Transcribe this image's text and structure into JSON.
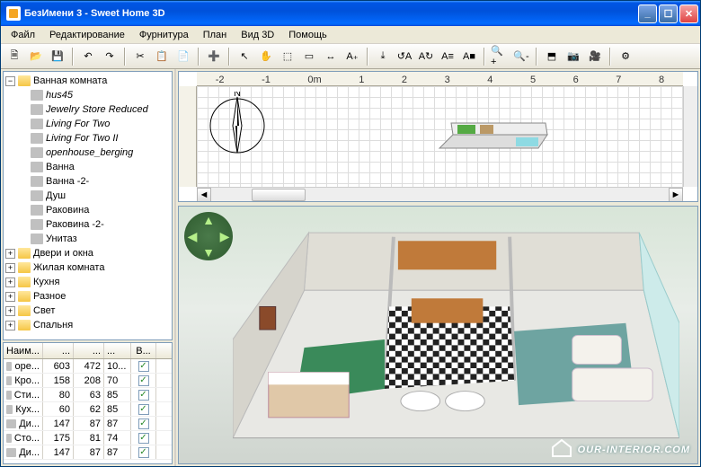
{
  "window": {
    "title": "БезИмени 3 - Sweet Home 3D",
    "min_label": "_",
    "max_label": "☐",
    "close_label": "✕"
  },
  "menu": {
    "file": "Файл",
    "edit": "Редактирование",
    "furniture": "Фурнитура",
    "plan": "План",
    "view3d": "Вид 3D",
    "help": "Помощь"
  },
  "toolbar_icons": {
    "new": "🗎",
    "open": "📂",
    "save": "💾",
    "undo": "↶",
    "redo": "↷",
    "cut": "✂",
    "copy": "📋",
    "paste": "📄",
    "add_furn": "➕",
    "select": "↖",
    "pan": "✋",
    "wall": "⬚",
    "room": "▭",
    "dimension": "↔",
    "text": "A₊",
    "import": "⤓",
    "rotate_left": "↺A",
    "rotate_right": "A↻",
    "align": "A≡",
    "color": "A■",
    "zoom_in": "🔍+",
    "zoom_out": "🔍-",
    "view_top": "⬒",
    "photo": "📷",
    "video": "🎥",
    "prefs": "⚙"
  },
  "catalog": {
    "root": "Ванная комната",
    "items": [
      {
        "label": "hus45",
        "italic": true
      },
      {
        "label": "Jewelry Store Reduced",
        "italic": true
      },
      {
        "label": "Living For Two",
        "italic": true
      },
      {
        "label": "Living For Two II",
        "italic": true
      },
      {
        "label": "openhouse_berging",
        "italic": true
      },
      {
        "label": "Ванна",
        "italic": false
      },
      {
        "label": "Ванна -2-",
        "italic": false
      },
      {
        "label": "Душ",
        "italic": false
      },
      {
        "label": "Раковина",
        "italic": false
      },
      {
        "label": "Раковина -2-",
        "italic": false
      },
      {
        "label": "Унитаз",
        "italic": false
      }
    ],
    "other_categories": [
      "Двери и окна",
      "Жилая комната",
      "Кухня",
      "Разное",
      "Свет",
      "Спальня"
    ]
  },
  "furniture_table": {
    "headers": [
      "Наим...",
      "...",
      "...",
      "...",
      "В..."
    ],
    "rows": [
      {
        "name": "оре...",
        "w": "603",
        "d": "472",
        "h": "10...",
        "vis": true
      },
      {
        "name": "Кро...",
        "w": "158",
        "d": "208",
        "h": "70",
        "vis": true
      },
      {
        "name": "Сти...",
        "w": "80",
        "d": "63",
        "h": "85",
        "vis": true
      },
      {
        "name": "Кух...",
        "w": "60",
        "d": "62",
        "h": "85",
        "vis": true
      },
      {
        "name": "Ди...",
        "w": "147",
        "d": "87",
        "h": "87",
        "vis": true
      },
      {
        "name": "Сто...",
        "w": "175",
        "d": "81",
        "h": "74",
        "vis": true
      },
      {
        "name": "Ди...",
        "w": "147",
        "d": "87",
        "h": "87",
        "vis": true
      }
    ]
  },
  "ruler_ticks": [
    "-2",
    "-1",
    "0m",
    "1",
    "2",
    "3",
    "4",
    "5",
    "6",
    "7",
    "8"
  ],
  "compass": {
    "n": "N"
  },
  "scroll": {
    "left": "◄",
    "right": "►"
  },
  "watermark": "OUR-INTERIOR.COM"
}
